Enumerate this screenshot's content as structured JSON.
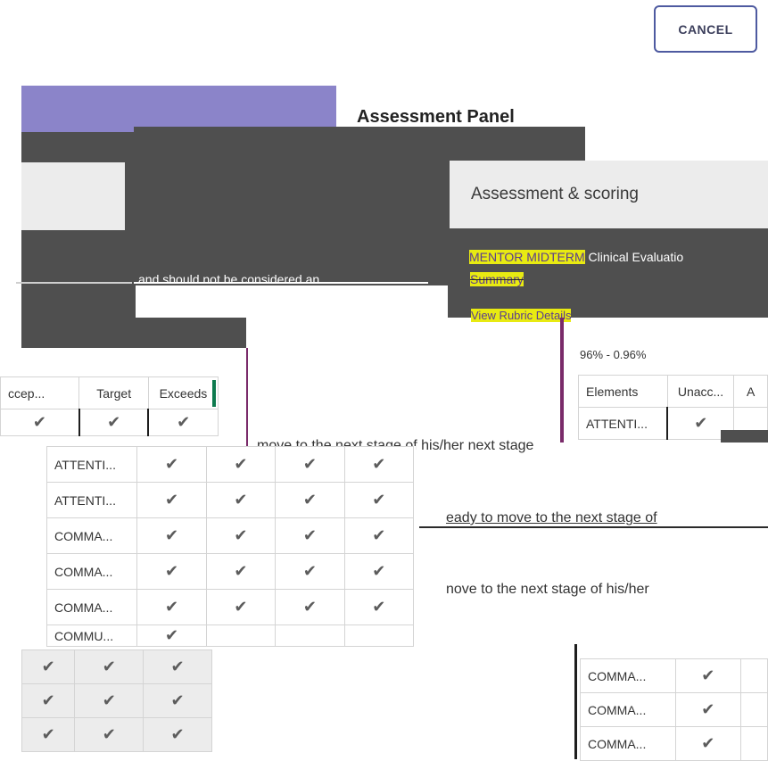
{
  "header": {
    "cancel_label": "CANCEL"
  },
  "panel": {
    "title": "Assessment Panel"
  },
  "scoring": {
    "title": "Assessment & scoring",
    "mentor_highlight": "MENTOR MIDTERM",
    "eval_suffix": " Clinical Evaluatio",
    "summary": "Summary",
    "rubric_link": "View Rubric Details",
    "percent": "96% - 0.96%"
  },
  "body_text": {
    "disclaimer": "and should not be considered an",
    "line1": "move to the next stage of his/her next stage",
    "line2": "eady to move to the next stage of",
    "line3": "nove to the next stage of his/her"
  },
  "left_table": {
    "headers": [
      "ccep...",
      "Target",
      "Exceeds"
    ]
  },
  "right_table": {
    "headers": [
      "Elements",
      "Unacc...",
      "A"
    ],
    "first_row": "ATTENTI..."
  },
  "middle_table": {
    "rows": [
      "ATTENTI...",
      "ATTENTI...",
      "COMMA...",
      "COMMA...",
      "COMMA...",
      "COMMU..."
    ]
  },
  "bottom_right_table": {
    "rows": [
      "COMMA...",
      "COMMA...",
      "COMMA..."
    ]
  },
  "icons": {
    "check": "check-icon"
  }
}
